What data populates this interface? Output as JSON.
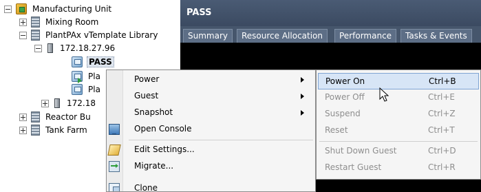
{
  "tree": {
    "items": [
      {
        "label": "Manufacturing Unit",
        "icon": "business-unit-icon",
        "expander": "minus"
      },
      {
        "label": "Mixing Room",
        "icon": "building-icon",
        "expander": "plus"
      },
      {
        "label": "PlantPAx vTemplate Library",
        "icon": "building-icon",
        "expander": "minus"
      },
      {
        "label": "172.18.27.96",
        "icon": "host-icon",
        "expander": "minus"
      },
      {
        "label": "PASS",
        "icon": "vm-icon",
        "selected": true
      },
      {
        "label": "Pla",
        "icon": "vm-powered-on-icon"
      },
      {
        "label": "Pla",
        "icon": "vm-icon"
      },
      {
        "label": "172.18",
        "icon": "host-icon",
        "expander": "plus"
      },
      {
        "label": "Reactor Bu",
        "icon": "building-icon",
        "expander": "plus"
      },
      {
        "label": "Tank Farm",
        "icon": "building-icon",
        "expander": "plus"
      }
    ]
  },
  "pane": {
    "title": "PASS",
    "tabs": [
      "Summary",
      "Resource Allocation",
      "Performance",
      "Tasks & Events"
    ]
  },
  "context_menu": {
    "items": [
      {
        "label": "Power",
        "submenu": true,
        "highlighted": true
      },
      {
        "label": "Guest",
        "submenu": true
      },
      {
        "label": "Snapshot",
        "submenu": true
      },
      {
        "label": "Open Console",
        "icon": "console-icon"
      },
      {
        "label": "Edit Settings...",
        "icon": "edit-settings-icon"
      },
      {
        "label": "Migrate...",
        "icon": "migrate-icon"
      },
      {
        "label": "Clone",
        "icon": "clone-icon"
      }
    ]
  },
  "power_submenu": {
    "items": [
      {
        "label": "Power On",
        "shortcut": "Ctrl+B",
        "enabled": true,
        "highlighted": true
      },
      {
        "label": "Power Off",
        "shortcut": "Ctrl+E",
        "enabled": false
      },
      {
        "label": "Suspend",
        "shortcut": "Ctrl+Z",
        "enabled": false
      },
      {
        "label": "Reset",
        "shortcut": "Ctrl+T",
        "enabled": false
      },
      {
        "label": "Shut Down Guest",
        "shortcut": "Ctrl+D",
        "enabled": false
      },
      {
        "label": "Restart Guest",
        "shortcut": "Ctrl+R",
        "enabled": false
      }
    ]
  },
  "colors": {
    "header_bg": "#3b4a61",
    "menu_bg": "#f5f5f5",
    "highlight": "#d7e5f6",
    "disabled_text": "#8e8e8e"
  }
}
